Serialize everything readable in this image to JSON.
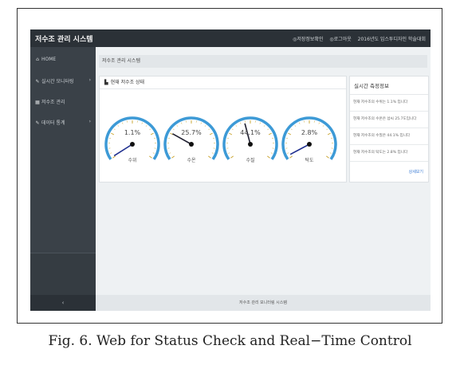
{
  "app": {
    "title": "저수조 관리 시스템"
  },
  "topbar": {
    "items": [
      "◎저장정보확인",
      "◎로그아웃",
      "2016년도 임스투디자인 학술대회"
    ]
  },
  "sidebar": {
    "items": [
      {
        "icon": "home-icon",
        "glyph": "⌂",
        "label": "HOME",
        "chevron": ""
      },
      {
        "icon": "wrench-icon",
        "glyph": "✎",
        "label": "실시간 모니터링",
        "chevron": "›"
      },
      {
        "icon": "grid-icon",
        "glyph": "▦",
        "label": "저수조 관리",
        "chevron": ""
      },
      {
        "icon": "wrench-icon",
        "glyph": "✎",
        "label": "데이터 통계",
        "chevron": "›"
      }
    ],
    "collapse_label": "‹"
  },
  "main": {
    "title": "저수조 관리 시스템",
    "panel_title": "현재 저수조 상태",
    "gauges": [
      {
        "value_text": "1.1%",
        "value": 1.1,
        "label": "수위"
      },
      {
        "value_text": "25.7%",
        "value": 25.7,
        "label": "수온"
      },
      {
        "value_text": "44.1%",
        "value": 44.1,
        "label": "수질"
      },
      {
        "value_text": "2.8%",
        "value": 2.8,
        "label": "탁도"
      }
    ],
    "colors": {
      "arc": "#3d9ad6",
      "needle_low": "#1f2f8f",
      "needle_mid": "#223",
      "tick": "#c9a22a"
    }
  },
  "realtime": {
    "title": "실시간 측정정보",
    "rows": [
      "현재 저수조의 수위는 1.1% 입니다",
      "현재 저수조의 수온은 섭씨 25.7도입니다",
      "현재 저수조의 수질은 44.1% 입니다",
      "현재 저수조의 탁도는 2.8% 입니다"
    ],
    "more_label": "상세보기"
  },
  "footer": {
    "text": "저수조 관리 모니터링 시스템"
  },
  "caption": "Fig. 6. Web for Status Check and Real−Time Control"
}
